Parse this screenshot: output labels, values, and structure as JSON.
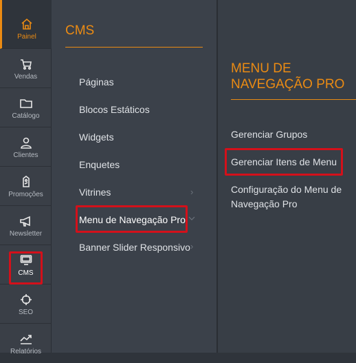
{
  "sidebar": {
    "items": [
      {
        "label": "Painel",
        "icon": "home-icon"
      },
      {
        "label": "Vendas",
        "icon": "cart-icon"
      },
      {
        "label": "Catálogo",
        "icon": "folder-icon"
      },
      {
        "label": "Clientes",
        "icon": "person-icon"
      },
      {
        "label": "Promoções",
        "icon": "tag-icon"
      },
      {
        "label": "Newsletter",
        "icon": "megaphone-icon"
      },
      {
        "label": "CMS",
        "icon": "monitor-icon"
      },
      {
        "label": "SEO",
        "icon": "crosshair-icon"
      },
      {
        "label": "Relatórios",
        "icon": "chart-icon"
      }
    ]
  },
  "cms": {
    "title": "CMS",
    "items": [
      {
        "label": "Páginas"
      },
      {
        "label": "Blocos Estáticos"
      },
      {
        "label": "Widgets"
      },
      {
        "label": "Enquetes"
      },
      {
        "label": "Vitrines"
      },
      {
        "label": "Menu de Navegação Pro"
      },
      {
        "label": "Banner Slider Responsivo"
      }
    ]
  },
  "submenu": {
    "title": "MENU DE NAVEGAÇÃO PRO",
    "items": [
      {
        "label": "Gerenciar Grupos"
      },
      {
        "label": "Gerenciar Itens de Menu"
      },
      {
        "label": "Configuração do Menu de Navegação Pro"
      }
    ]
  },
  "colors": {
    "accent": "#eb8b13",
    "highlight": "#d4101a"
  }
}
